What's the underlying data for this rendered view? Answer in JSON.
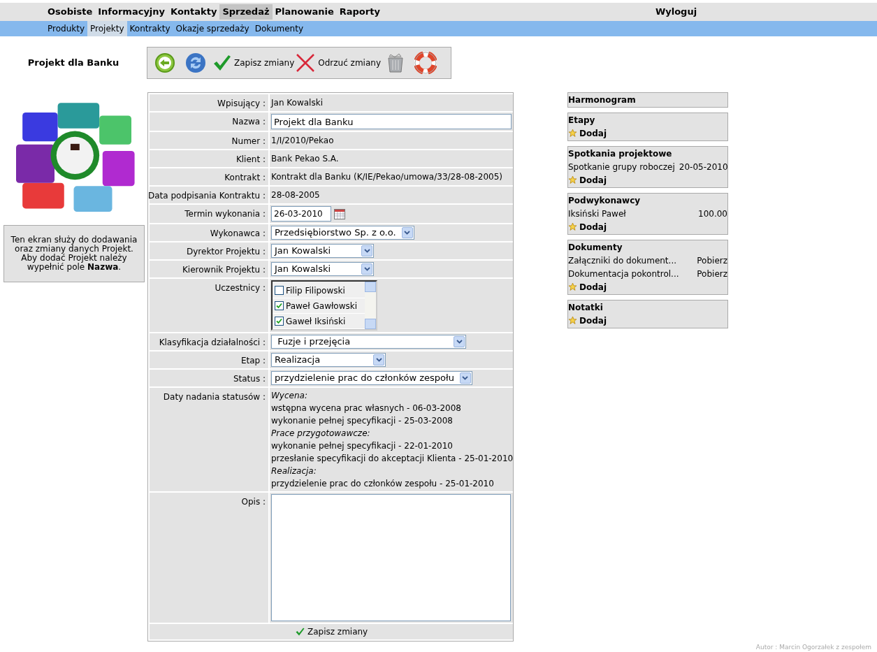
{
  "nav": {
    "main": [
      {
        "label": "Osobiste",
        "selected": false
      },
      {
        "label": "Informacyjny",
        "selected": false
      },
      {
        "label": "Kontakty",
        "selected": false
      },
      {
        "label": "Sprzedaż",
        "selected": true
      },
      {
        "label": "Planowanie",
        "selected": false
      },
      {
        "label": "Raporty",
        "selected": false
      }
    ],
    "logout": "Wyloguj",
    "sub": [
      {
        "label": "Produkty",
        "selected": false
      },
      {
        "label": "Projekty",
        "selected": true
      },
      {
        "label": "Kontrakty",
        "selected": false
      },
      {
        "label": "Okazje sprzedaży",
        "selected": false
      },
      {
        "label": "Dokumenty",
        "selected": false
      }
    ]
  },
  "page_title": "Projekt dla Banku",
  "toolbar": [
    {
      "kind": "back"
    },
    {
      "kind": "refresh"
    },
    {
      "kind": "save",
      "label": "Zapisz zmiany"
    },
    {
      "kind": "discard",
      "label": "Odrzuć zmiany"
    },
    {
      "kind": "delete"
    },
    {
      "kind": "help"
    }
  ],
  "info_text": "Ten ekran służy do dodawania oraz zmiany danych Projekt. Aby dodać Projekt należy wypełnić pole **Nazwa**.",
  "form": {
    "rows": [
      {
        "label": "Wpisujący :",
        "kind": "text",
        "value": "Jan Kowalski"
      },
      {
        "label": "Nazwa :",
        "kind": "input",
        "value": "Projekt dla Banku"
      },
      {
        "label": "Numer :",
        "kind": "text",
        "value": "1/I/2010/Pekao"
      },
      {
        "label": "Klient :",
        "kind": "text",
        "value": "Bank Pekao S.A."
      },
      {
        "label": "Kontrakt :",
        "kind": "text",
        "value": "Kontrakt dla Banku (K/IE/Pekao/umowa/33/28-08-2005)"
      },
      {
        "label": "Data podpisania Kontraktu :",
        "kind": "text",
        "value": "28-08-2005"
      },
      {
        "label": "Termin wykonania :",
        "kind": "date",
        "value": "26-03-2010"
      },
      {
        "label": "Wykonawca :",
        "kind": "select",
        "value": "Przedsiębiorstwo Sp. z o.o."
      },
      {
        "label": "Dyrektor Projektu :",
        "kind": "select",
        "value": "Jan Kowalski"
      },
      {
        "label": "Kierownik Projektu :",
        "kind": "select",
        "value": "Jan Kowalski"
      },
      {
        "label": "Uczestnicy :",
        "kind": "checklist",
        "items": [
          {
            "label": "Filip Filipowski",
            "checked": false
          },
          {
            "label": "Paweł Gawłowski",
            "checked": true
          },
          {
            "label": "Gaweł Iksiński",
            "checked": true
          }
        ]
      },
      {
        "label": "Klasyfikacja działalności :",
        "kind": "select",
        "value": " Fuzje i przejęcia"
      },
      {
        "label": "Etap :",
        "kind": "select",
        "value": "Realizacja"
      },
      {
        "label": "Status :",
        "kind": "select",
        "value": "przydzielenie prac do członków zespołu"
      },
      {
        "label": "Daty nadania statusów :",
        "kind": "history",
        "lines": [
          {
            "kind": "heading",
            "text": "Wycena:"
          },
          {
            "kind": "entry",
            "text": "wstępna wycena prac własnych - 06-03-2008"
          },
          {
            "kind": "entry",
            "text": "wykonanie pełnej specyfikacji - 25-03-2008"
          },
          {
            "kind": "heading",
            "text": "Prace przygotowawcze:"
          },
          {
            "kind": "entry",
            "text": "wykonanie pełnej specyfikacji - 22-01-2010"
          },
          {
            "kind": "entry",
            "text": "przesłanie specyfikacji do akceptacji Klienta - 25-01-2010"
          },
          {
            "kind": "heading",
            "text": "Realizacja:"
          },
          {
            "kind": "entry",
            "text": "przydzielenie prac do członków zespołu - 25-01-2010"
          }
        ]
      },
      {
        "label": "Opis :",
        "kind": "textarea"
      }
    ],
    "save_label": "Zapisz zmiany"
  },
  "sidebar": {
    "title": "Harmonogram",
    "sections": [
      {
        "title": "Etapy",
        "add_label": "Dodaj"
      },
      {
        "title": "Spotkania projektowe",
        "rows": [
          {
            "name": "Spotkanie grupy roboczej",
            "value": "20-05-2010"
          }
        ],
        "add_label": "Dodaj"
      },
      {
        "title": "Podwykonawcy",
        "rows": [
          {
            "name": "Iksiński Paweł",
            "value": "100.00"
          }
        ],
        "add_label": "Dodaj"
      },
      {
        "title": "Dokumenty",
        "rows": [
          {
            "name": "Załączniki do dokument...",
            "value": "Pobierz"
          },
          {
            "name": "Dokumentacja pokontrol...",
            "value": "Pobierz"
          }
        ],
        "add_label": "Dodaj"
      },
      {
        "title": "Notatki",
        "add_label": "Dodaj"
      }
    ]
  },
  "footer": "Autor : Marcin Ogorzałek z zespołem"
}
